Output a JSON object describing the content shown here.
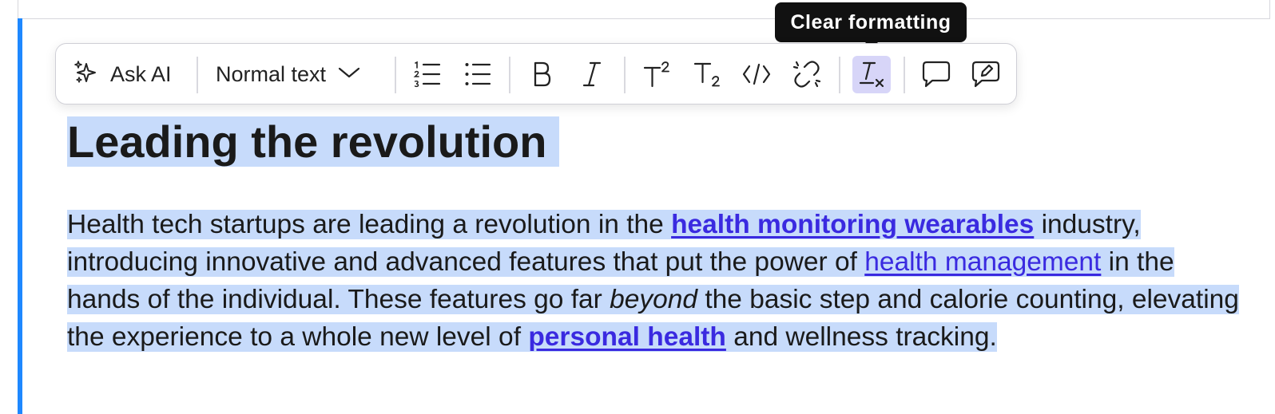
{
  "toolbar": {
    "ask_ai_label": "Ask AI",
    "text_style_value": "Normal text",
    "icons": [
      "sparkles-icon",
      "chevron-down-icon",
      "numbered-list-icon",
      "bulleted-list-icon",
      "bold-icon",
      "italic-icon",
      "superscript-icon",
      "subscript-icon",
      "code-icon",
      "unlink-icon",
      "clear-formatting-icon",
      "comment-icon",
      "edit-comment-icon"
    ],
    "active_color": "#d7d5f8"
  },
  "tooltip": {
    "text": "Clear formatting"
  },
  "content": {
    "heading": "Leading the revolution",
    "p_part1": "Health tech startups are leading a revolution in the ",
    "link1": "health monitoring wearables",
    "p_part2": " industry, introducing innovative and advanced features that put the power of ",
    "link2": "health management",
    "p_part3": " in the hands of the individual. These features go far ",
    "italic1": "beyond",
    "p_part4": " the basic step and calorie counting, elevating the experience to a whole new level of ",
    "link3": "personal health",
    "p_part5": " and wellness tracking."
  },
  "colors": {
    "selection": "#c7dbfb",
    "link": "#3a2ae0",
    "focus_bar": "#1e88ff",
    "tooltip_bg": "#111111"
  }
}
